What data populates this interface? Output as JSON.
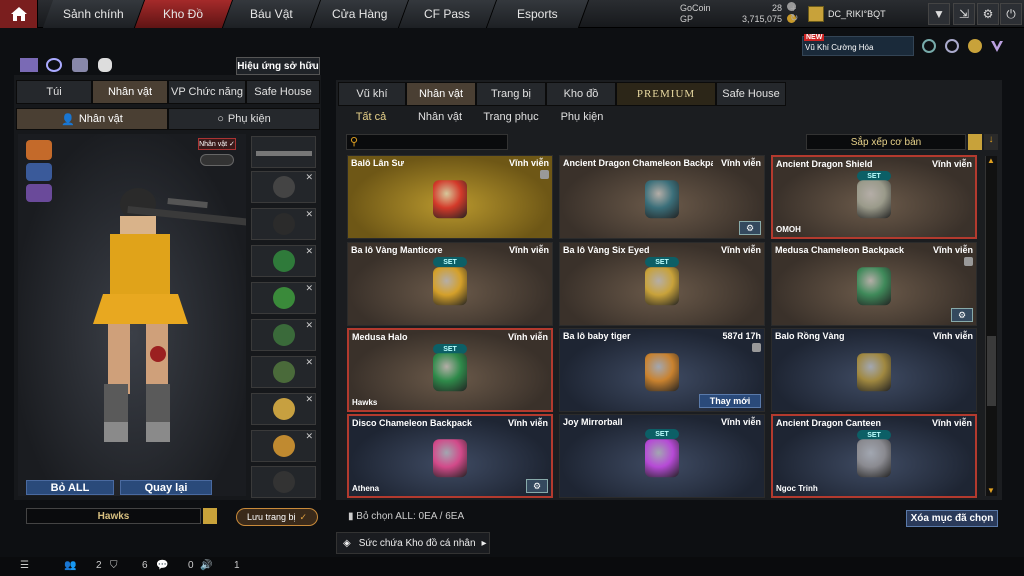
{
  "topnav": {
    "tabs": [
      "Sảnh chính",
      "Kho Đồ",
      "Báu Vật",
      "Cửa Hàng",
      "CF Pass",
      "Esports"
    ],
    "gocoin_label": "GoCoin",
    "gocoin_value": "28",
    "gp_label": "GP",
    "gp_value": "3,715,075",
    "username": "DC_RIKI°BQT"
  },
  "promo": {
    "badge": "NEW",
    "title": "Vũ Khí Cường Hóa"
  },
  "left": {
    "owned_effects": "Hiệu ứng sở hữu",
    "tabs": [
      "Túi",
      "Nhân vật",
      "VP Chức năng",
      "Safe House"
    ],
    "subtabs": [
      "Nhân vật",
      "Phụ kiện"
    ],
    "char_badge": "Nhân vật ✓",
    "btn_remove_all": "Bỏ ALL",
    "btn_back": "Quay lại",
    "hawks_label": "Hawks",
    "save_outfit": "Lưu trang bị"
  },
  "right": {
    "tabs": [
      "Vũ khí",
      "Nhân vật",
      "Trang bị",
      "Kho đồ",
      "PREMIUM",
      "Safe House"
    ],
    "subtabs": [
      "Tất cả",
      "Nhân vật",
      "Trang phục",
      "Phụ kiện"
    ],
    "sort_label": "Sắp xếp cơ bản",
    "selected_count": "Bỏ chọn ALL: 0EA / 6EA",
    "clear_selected": "Xóa mục đã chọn",
    "capacity": "Sức chứa Kho đồ cá nhân"
  },
  "items": [
    {
      "name": "Balô Lân Sư",
      "dur": "Vĩnh viễn",
      "set": "",
      "tag": "",
      "style": "gold",
      "sel": false,
      "gear": false,
      "lock": true,
      "color": "#d33a2a"
    },
    {
      "name": "Ancient Dragon Chameleon Backpack",
      "dur": "Vĩnh viễn",
      "set": "",
      "tag": "",
      "style": "",
      "sel": false,
      "gear": true,
      "lock": false,
      "color": "#3b6f7a"
    },
    {
      "name": "Ancient Dragon Shield",
      "dur": "Vĩnh viễn",
      "set": "SET",
      "tag": "OMOH",
      "style": "",
      "sel": true,
      "gear": false,
      "lock": false,
      "color": "#9a9a8a"
    },
    {
      "name": "Ba lô Vàng Manticore",
      "dur": "Vĩnh viễn",
      "set": "SET",
      "tag": "",
      "style": "",
      "sel": false,
      "gear": false,
      "lock": false,
      "color": "#d4a02a"
    },
    {
      "name": "Ba lô Vàng Six Eyed",
      "dur": "Vĩnh viễn",
      "set": "SET",
      "tag": "",
      "style": "",
      "sel": false,
      "gear": false,
      "lock": false,
      "color": "#c8a23a"
    },
    {
      "name": "Medusa Chameleon Backpack",
      "dur": "Vĩnh viễn",
      "set": "",
      "tag": "",
      "style": "",
      "sel": false,
      "gear": true,
      "lock": true,
      "color": "#3f8a5a"
    },
    {
      "name": "Medusa Halo",
      "dur": "Vĩnh viễn",
      "set": "SET",
      "tag": "Hawks",
      "style": "",
      "sel": true,
      "gear": false,
      "lock": false,
      "color": "#2f8a4a"
    },
    {
      "name": "Ba lô baby tiger",
      "dur": "587d 17h",
      "set": "",
      "tag": "",
      "style": "blue",
      "sel": false,
      "gear": false,
      "lock": true,
      "color": "#c9822f",
      "action": "Thay mới"
    },
    {
      "name": "Balo Rồng Vàng",
      "dur": "Vĩnh viễn",
      "set": "",
      "tag": "",
      "style": "blue",
      "sel": false,
      "gear": false,
      "lock": false,
      "color": "#a08840"
    },
    {
      "name": "Disco Chameleon Backpack",
      "dur": "Vĩnh viễn",
      "set": "",
      "tag": "Athena",
      "style": "blue",
      "sel": true,
      "gear": true,
      "lock": false,
      "color": "#d24a8a"
    },
    {
      "name": "Joy Mirrorball",
      "dur": "Vĩnh viễn",
      "set": "SET",
      "tag": "",
      "style": "blue",
      "sel": false,
      "gear": false,
      "lock": false,
      "color": "#b64ad6"
    },
    {
      "name": "Ancient Dragon Canteen",
      "dur": "Vĩnh viễn",
      "set": "SET",
      "tag": "Ngoc Trinh",
      "style": "blue",
      "sel": true,
      "gear": false,
      "lock": false,
      "color": "#8a8a90"
    }
  ],
  "side_slots": [
    {
      "color": "#5a5a5a"
    },
    {
      "color": "#444"
    },
    {
      "color": "#2b2b2b"
    },
    {
      "color": "#2f7a3a"
    },
    {
      "color": "#3a8a3a"
    },
    {
      "color": "#3a6a3a"
    },
    {
      "color": "#4a6a3a"
    },
    {
      "color": "#c7a040"
    },
    {
      "color": "#c08a30"
    },
    {
      "color": "#333"
    }
  ],
  "bottombar": {
    "friends": "2",
    "guild": "6",
    "chat": "0",
    "voice": "1"
  }
}
